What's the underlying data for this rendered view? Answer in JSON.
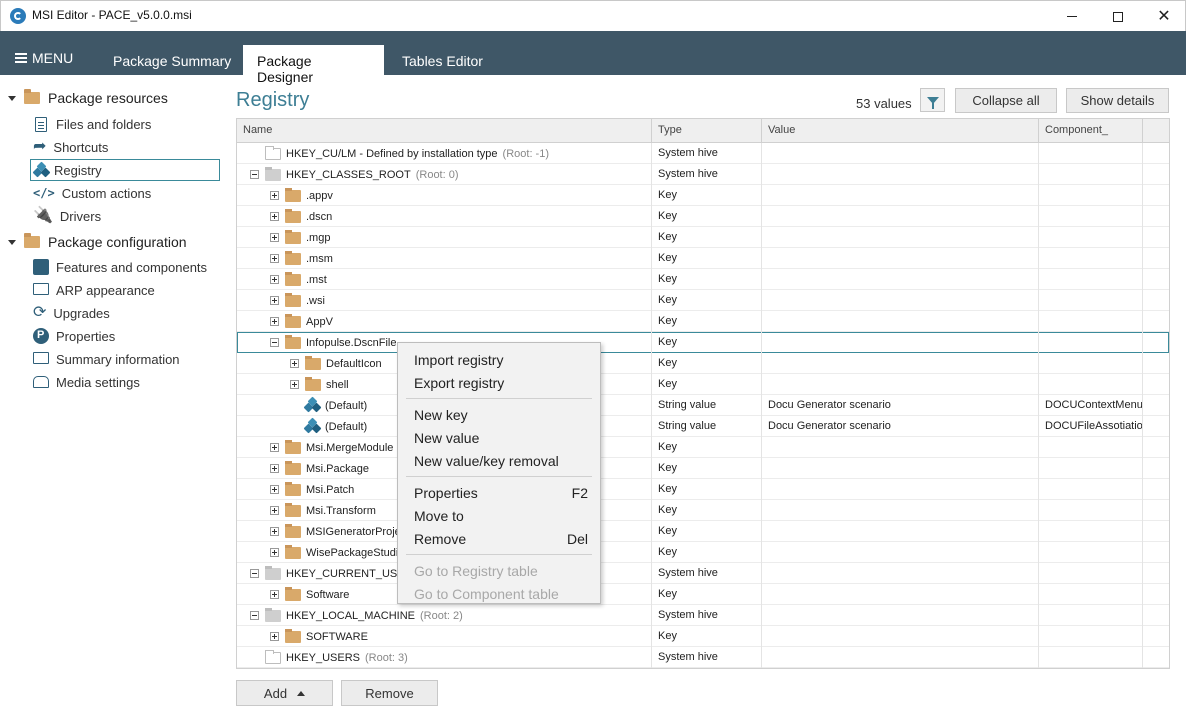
{
  "window": {
    "title": "MSI Editor - PACE_v5.0.0.msi"
  },
  "menubar": {
    "menu_label": "MENU",
    "tabs": [
      "Package Summary",
      "Package Designer",
      "Tables Editor"
    ],
    "active_tab": "Package Designer"
  },
  "sidebar": {
    "sections": [
      {
        "label": "Package resources",
        "items": [
          "Files and folders",
          "Shortcuts",
          "Registry",
          "Custom actions",
          "Drivers"
        ]
      },
      {
        "label": "Package configuration",
        "items": [
          "Features and components",
          "ARP appearance",
          "Upgrades",
          "Properties",
          "Summary information",
          "Media settings"
        ]
      }
    ],
    "selected": "Registry"
  },
  "main": {
    "title": "Registry",
    "values_count": "53 values",
    "collapse_label": "Collapse all",
    "details_label": "Show details",
    "columns": [
      "Name",
      "Type",
      "Value",
      "Component_"
    ],
    "rows": [
      {
        "depth": 0,
        "exp": "none",
        "icon": "hollow",
        "name": "HKEY_CU/LM - Defined by installation type",
        "root": "(Root: -1)",
        "type": "System hive",
        "value": "",
        "component": ""
      },
      {
        "depth": 0,
        "exp": "minus",
        "icon": "gray",
        "name": "HKEY_CLASSES_ROOT",
        "root": "(Root: 0)",
        "type": "System hive",
        "value": "",
        "component": ""
      },
      {
        "depth": 1,
        "exp": "plus",
        "icon": "folder",
        "name": ".appv",
        "root": "",
        "type": "Key",
        "value": "",
        "component": ""
      },
      {
        "depth": 1,
        "exp": "plus",
        "icon": "folder",
        "name": ".dscn",
        "root": "",
        "type": "Key",
        "value": "",
        "component": ""
      },
      {
        "depth": 1,
        "exp": "plus",
        "icon": "folder",
        "name": ".mgp",
        "root": "",
        "type": "Key",
        "value": "",
        "component": ""
      },
      {
        "depth": 1,
        "exp": "plus",
        "icon": "folder",
        "name": ".msm",
        "root": "",
        "type": "Key",
        "value": "",
        "component": ""
      },
      {
        "depth": 1,
        "exp": "plus",
        "icon": "folder",
        "name": ".mst",
        "root": "",
        "type": "Key",
        "value": "",
        "component": ""
      },
      {
        "depth": 1,
        "exp": "plus",
        "icon": "folder",
        "name": ".wsi",
        "root": "",
        "type": "Key",
        "value": "",
        "component": ""
      },
      {
        "depth": 1,
        "exp": "plus",
        "icon": "folder",
        "name": "AppV",
        "root": "",
        "type": "Key",
        "value": "",
        "component": ""
      },
      {
        "depth": 1,
        "exp": "minus",
        "icon": "folder",
        "name": "Infopulse.DscnFile",
        "root": "",
        "type": "Key",
        "value": "",
        "component": "",
        "highlight": true
      },
      {
        "depth": 2,
        "exp": "plus",
        "icon": "folder",
        "name": "DefaultIcon",
        "root": "",
        "type": "Key",
        "value": "",
        "component": ""
      },
      {
        "depth": 2,
        "exp": "plus",
        "icon": "folder",
        "name": "shell",
        "root": "",
        "type": "Key",
        "value": "",
        "component": ""
      },
      {
        "depth": 2,
        "exp": "none",
        "icon": "value",
        "name": "(Default)",
        "root": "",
        "type": "String value",
        "value": "Docu Generator scenario",
        "component": "DOCUContextMenu"
      },
      {
        "depth": 2,
        "exp": "none",
        "icon": "value",
        "name": "(Default)",
        "root": "",
        "type": "String value",
        "value": "Docu Generator scenario",
        "component": "DOCUFileAssotiatio"
      },
      {
        "depth": 1,
        "exp": "plus",
        "icon": "folder",
        "name": "Msi.MergeModule",
        "root": "",
        "type": "Key",
        "value": "",
        "component": ""
      },
      {
        "depth": 1,
        "exp": "plus",
        "icon": "folder",
        "name": "Msi.Package",
        "root": "",
        "type": "Key",
        "value": "",
        "component": ""
      },
      {
        "depth": 1,
        "exp": "plus",
        "icon": "folder",
        "name": "Msi.Patch",
        "root": "",
        "type": "Key",
        "value": "",
        "component": ""
      },
      {
        "depth": 1,
        "exp": "plus",
        "icon": "folder",
        "name": "Msi.Transform",
        "root": "",
        "type": "Key",
        "value": "",
        "component": ""
      },
      {
        "depth": 1,
        "exp": "plus",
        "icon": "folder",
        "name": "MSIGeneratorProje",
        "root": "",
        "type": "Key",
        "value": "",
        "component": ""
      },
      {
        "depth": 1,
        "exp": "plus",
        "icon": "folder",
        "name": "WisePackageStudio",
        "root": "",
        "type": "Key",
        "value": "",
        "component": ""
      },
      {
        "depth": 0,
        "exp": "minus",
        "icon": "gray",
        "name": "HKEY_CURRENT_USER",
        "root": "",
        "type": "System hive",
        "value": "",
        "component": ""
      },
      {
        "depth": 1,
        "exp": "plus",
        "icon": "folder",
        "name": "Software",
        "root": "",
        "type": "Key",
        "value": "",
        "component": ""
      },
      {
        "depth": 0,
        "exp": "minus",
        "icon": "gray",
        "name": "HKEY_LOCAL_MACHINE",
        "root": "(Root: 2)",
        "type": "System hive",
        "value": "",
        "component": ""
      },
      {
        "depth": 1,
        "exp": "plus",
        "icon": "folder",
        "name": "SOFTWARE",
        "root": "",
        "type": "Key",
        "value": "",
        "component": ""
      },
      {
        "depth": 0,
        "exp": "none",
        "icon": "hollow",
        "name": "HKEY_USERS",
        "root": "(Root: 3)",
        "type": "System hive",
        "value": "",
        "component": ""
      }
    ],
    "add_label": "Add",
    "remove_label": "Remove"
  },
  "context_menu": {
    "items": [
      {
        "label": "Import registry",
        "shortcut": "",
        "enabled": true
      },
      {
        "label": "Export registry",
        "shortcut": "",
        "enabled": true
      },
      {
        "sep": true
      },
      {
        "label": "New key",
        "shortcut": "",
        "enabled": true
      },
      {
        "label": "New value",
        "shortcut": "",
        "enabled": true
      },
      {
        "label": "New value/key removal",
        "shortcut": "",
        "enabled": true
      },
      {
        "sep": true
      },
      {
        "label": "Properties",
        "shortcut": "F2",
        "enabled": true
      },
      {
        "label": "Move to",
        "shortcut": "",
        "enabled": true
      },
      {
        "label": "Remove",
        "shortcut": "Del",
        "enabled": true
      },
      {
        "sep": true
      },
      {
        "label": "Go to Registry table",
        "shortcut": "",
        "enabled": false
      },
      {
        "label": "Go to Component table",
        "shortcut": "",
        "enabled": false
      }
    ]
  },
  "colors": {
    "menubar": "#3f5767",
    "accent": "#3d7e94",
    "folder": "#d9a96a"
  }
}
